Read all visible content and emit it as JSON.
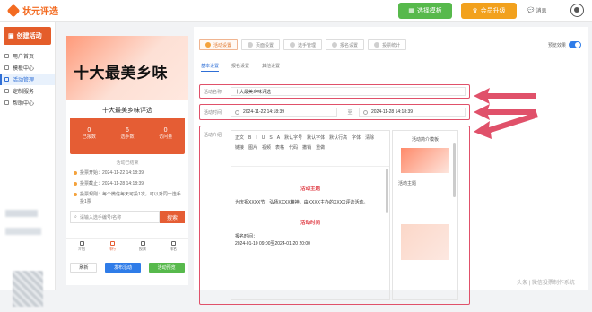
{
  "header": {
    "logo_text": "状元评选",
    "template_button": "选择模板",
    "vip_button": "会员升级",
    "message_label": "消息"
  },
  "sidebar": {
    "create_button": "创建活动",
    "items": [
      {
        "label": "用户首页"
      },
      {
        "label": "模板中心"
      },
      {
        "label": "活动管理"
      },
      {
        "label": "定制服务"
      },
      {
        "label": "帮助中心"
      }
    ]
  },
  "preview": {
    "banner_title": "十大最美乡味",
    "card_title": "十大最美乡味评选",
    "stats": [
      {
        "num": "0",
        "label": "已报数"
      },
      {
        "num": "6",
        "label": "选手数"
      },
      {
        "num": "0",
        "label": "访问量"
      }
    ],
    "ended": "活动已结束",
    "info": [
      "投票开始：2024-11-22 14:18:39",
      "投票截止：2024-11-28 14:18:39",
      "投票规则：每个微信每天可投1次，可以对同一选手投1票"
    ],
    "search_placeholder": "请输入选手编号/名称",
    "search_button": "搜索",
    "tabs": [
      "介绍",
      "排行",
      "投票",
      "排名"
    ],
    "actions": {
      "refresh": "刷新",
      "publish": "发布活动",
      "preview": "活动预览"
    }
  },
  "settings": {
    "steps": [
      "活动设置",
      "页面设置",
      "选手管理",
      "报名设置",
      "投票统计"
    ],
    "preview_toggle_label": "预览效果",
    "subtabs": [
      "基本设置",
      "报名设置",
      "其他设置"
    ],
    "name_label": "活动名称",
    "name_value": "十大最美乡味评选",
    "time_label": "活动时间",
    "time_start": "2024-11-22 14:18:39",
    "time_sep": "至",
    "time_end": "2024-11-28 14:18:39",
    "intro_label": "活动介绍",
    "toolbar": [
      "正文",
      "B",
      "I",
      "U",
      "S",
      "A",
      "默认字号",
      "默认字体",
      "默认行高",
      "字体",
      "清除",
      "链接",
      "图片",
      "视频",
      "表格",
      "代码",
      "撤销",
      "重做"
    ],
    "doc": {
      "heading1": "活动主题",
      "para1": "为庆祝XXXX节，弘扬XXXX精神，由XXXX主办的XXXX评选活动。",
      "heading2": "活动时间",
      "para2": "报名时间：",
      "para3": "2024-01-10 09:00至2024-01-20 20:00"
    },
    "template_panel": {
      "title": "活动简介模板",
      "label1": "活动主题"
    }
  },
  "watermark": "头条 | 微信投票制作系统"
}
